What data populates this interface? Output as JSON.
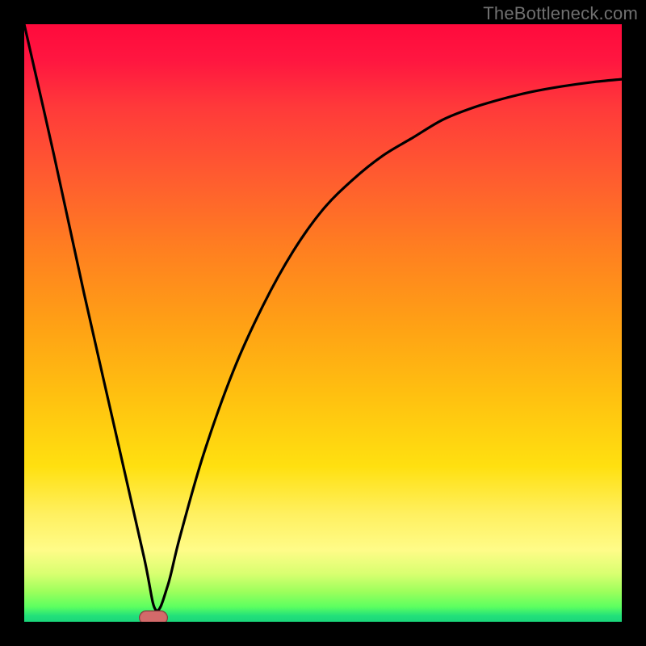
{
  "watermark": "TheBottleneck.com",
  "colors": {
    "frame": "#000000",
    "curve": "#000000",
    "marker_fill": "#d36a6a",
    "marker_border": "#823a3a"
  },
  "chart_data": {
    "type": "line",
    "title": "",
    "xlabel": "",
    "ylabel": "",
    "xlim": [
      0,
      100
    ],
    "ylim": [
      0,
      100
    ],
    "grid": false,
    "legend": false,
    "note": "No axis ticks or numeric labels are rendered; values are estimated from geometry. Y appears inverted (0 at bottom = optimal/green, 100 at top = red).",
    "series": [
      {
        "name": "bottleneck-curve",
        "x": [
          0,
          5,
          10,
          15,
          20,
          22,
          24,
          26,
          30,
          35,
          40,
          45,
          50,
          55,
          60,
          65,
          70,
          75,
          80,
          85,
          90,
          95,
          100
        ],
        "y": [
          100,
          78,
          55,
          33,
          11,
          2,
          6,
          14,
          28,
          42,
          53,
          62,
          69,
          74,
          78,
          81,
          84,
          86,
          87.5,
          88.7,
          89.6,
          90.3,
          90.8
        ]
      }
    ],
    "annotations": [
      {
        "name": "optimal-marker",
        "shape": "pill",
        "x": 21.5,
        "y": 0.8
      }
    ],
    "background_gradient": {
      "direction": "top-to-bottom",
      "stops": [
        {
          "pos": 0.0,
          "color": "#ff0a3c"
        },
        {
          "pos": 0.5,
          "color": "#ffa015"
        },
        {
          "pos": 0.88,
          "color": "#fffc88"
        },
        {
          "pos": 1.0,
          "color": "#1ad67a"
        }
      ]
    }
  }
}
